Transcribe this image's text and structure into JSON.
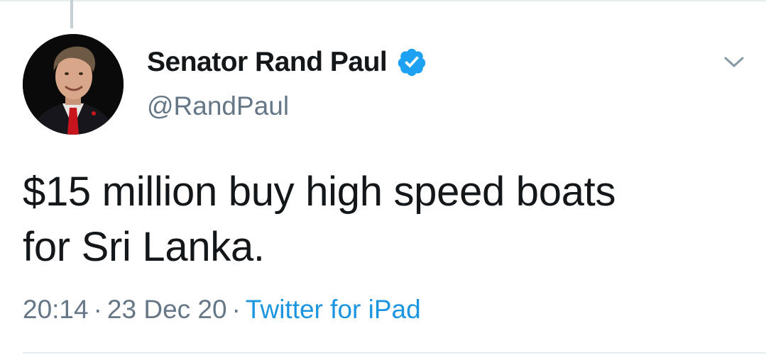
{
  "tweet": {
    "author": {
      "display_name": "Senator Rand Paul",
      "handle": "@RandPaul",
      "verified": true
    },
    "text_line1": "$15 million buy high speed boats",
    "text_line2": "for Sri Lanka.",
    "time": "20:14",
    "separator": "·",
    "date": "23 Dec 20",
    "source": "Twitter for iPad"
  },
  "icons": {
    "verified": "verified-badge-icon",
    "menu": "chevron-down-icon"
  },
  "colors": {
    "text": "#14171a",
    "secondary": "#657786",
    "link": "#1b95e0",
    "verified": "#1da1f2"
  }
}
